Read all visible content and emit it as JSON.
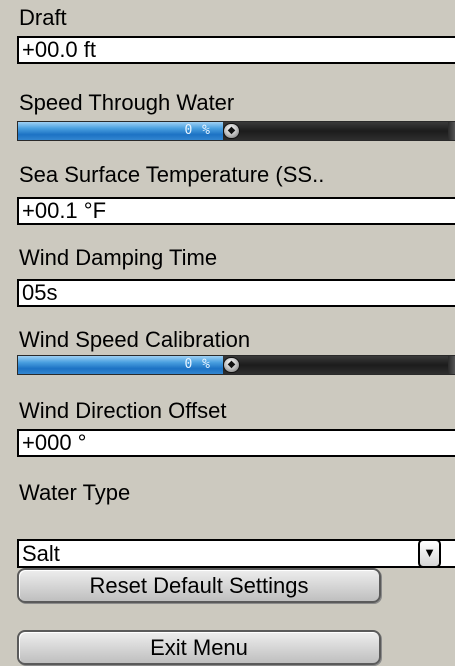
{
  "draft": {
    "label": "Draft",
    "value": "+00.0 ft"
  },
  "speed_through_water": {
    "label": "Speed Through Water",
    "percent_text": "0 %",
    "level_percent": 0
  },
  "sea_surface_temperature": {
    "label": "Sea Surface Temperature (SS..",
    "value": "+00.1 °F"
  },
  "wind_damping_time": {
    "label": "Wind Damping Time",
    "value": "05s"
  },
  "wind_speed_calibration": {
    "label": "Wind Speed Calibration",
    "percent_text": "0 %",
    "level_percent": 0
  },
  "wind_direction_offset": {
    "label": "Wind Direction Offset",
    "value": "+000 °"
  },
  "water_type": {
    "label": "Water Type",
    "selected": "Salt",
    "dropdown_icon": "triangle-down-icon"
  },
  "buttons": {
    "reset": "Reset Default Settings",
    "exit": "Exit Menu"
  },
  "colors": {
    "background": "#ccc9bf",
    "slider_fill": "#1c72c4"
  }
}
